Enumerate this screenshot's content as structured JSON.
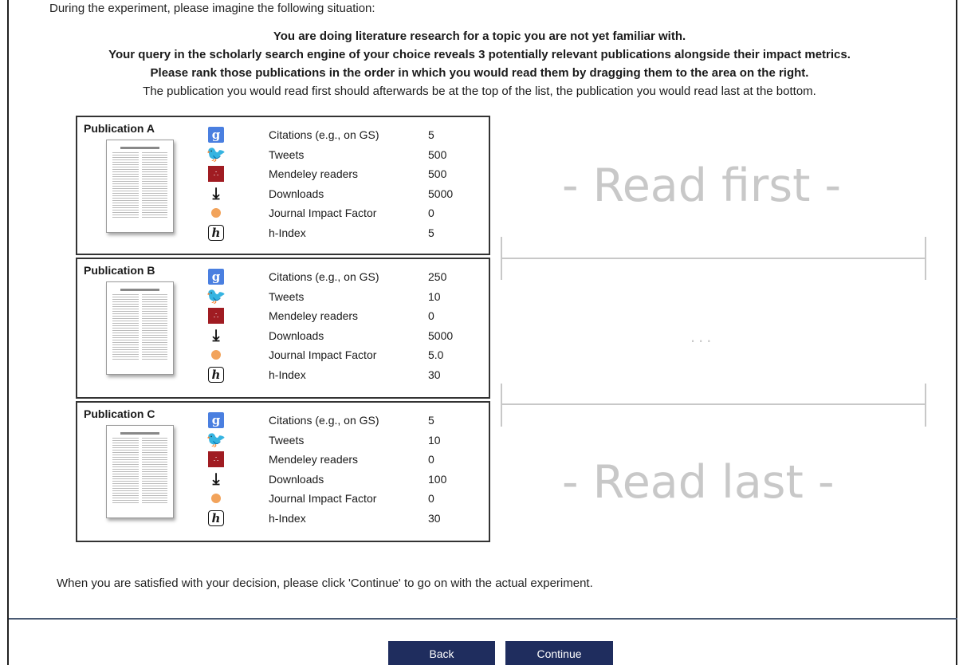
{
  "intro": "During the experiment, please imagine the following situation:",
  "scenario": {
    "line1": "You are doing literature research for a topic you are not yet familiar with.",
    "line2": "Your query in the scholarly search engine of your choice reveals 3 potentially relevant publications alongside their impact metrics.",
    "line3": "Please rank those publications in the order in which you would read them by dragging them to the area on the right.",
    "line4": "The publication you would read first should afterwards be at the top of the list, the publication you would read last at the bottom."
  },
  "metric_labels": [
    "Citations (e.g., on GS)",
    "Tweets",
    "Mendeley readers",
    "Downloads",
    "Journal Impact Factor",
    "h-Index"
  ],
  "metric_icons": [
    "google-scholar-icon",
    "twitter-icon",
    "mendeley-icon",
    "download-icon",
    "journal-impact-icon",
    "h-index-icon"
  ],
  "publications": [
    {
      "title": "Publication A",
      "values": [
        "5",
        "500",
        "500",
        "5000",
        "0",
        "5"
      ]
    },
    {
      "title": "Publication B",
      "values": [
        "250",
        "10",
        "0",
        "5000",
        "5.0",
        "30"
      ]
    },
    {
      "title": "Publication C",
      "values": [
        "5",
        "10",
        "0",
        "100",
        "0",
        "30"
      ]
    }
  ],
  "ranking": {
    "top_label": "- Read first -",
    "middle_label": "...",
    "bottom_label": "- Read last -"
  },
  "satisfied_text": "When you are satisfied with your decision, please click 'Continue' to go on with the actual experiment.",
  "buttons": {
    "back": "Back",
    "continue": "Continue"
  },
  "colors": {
    "button_bg": "#1f2d5e",
    "drop_text": "#c8c8c8"
  }
}
